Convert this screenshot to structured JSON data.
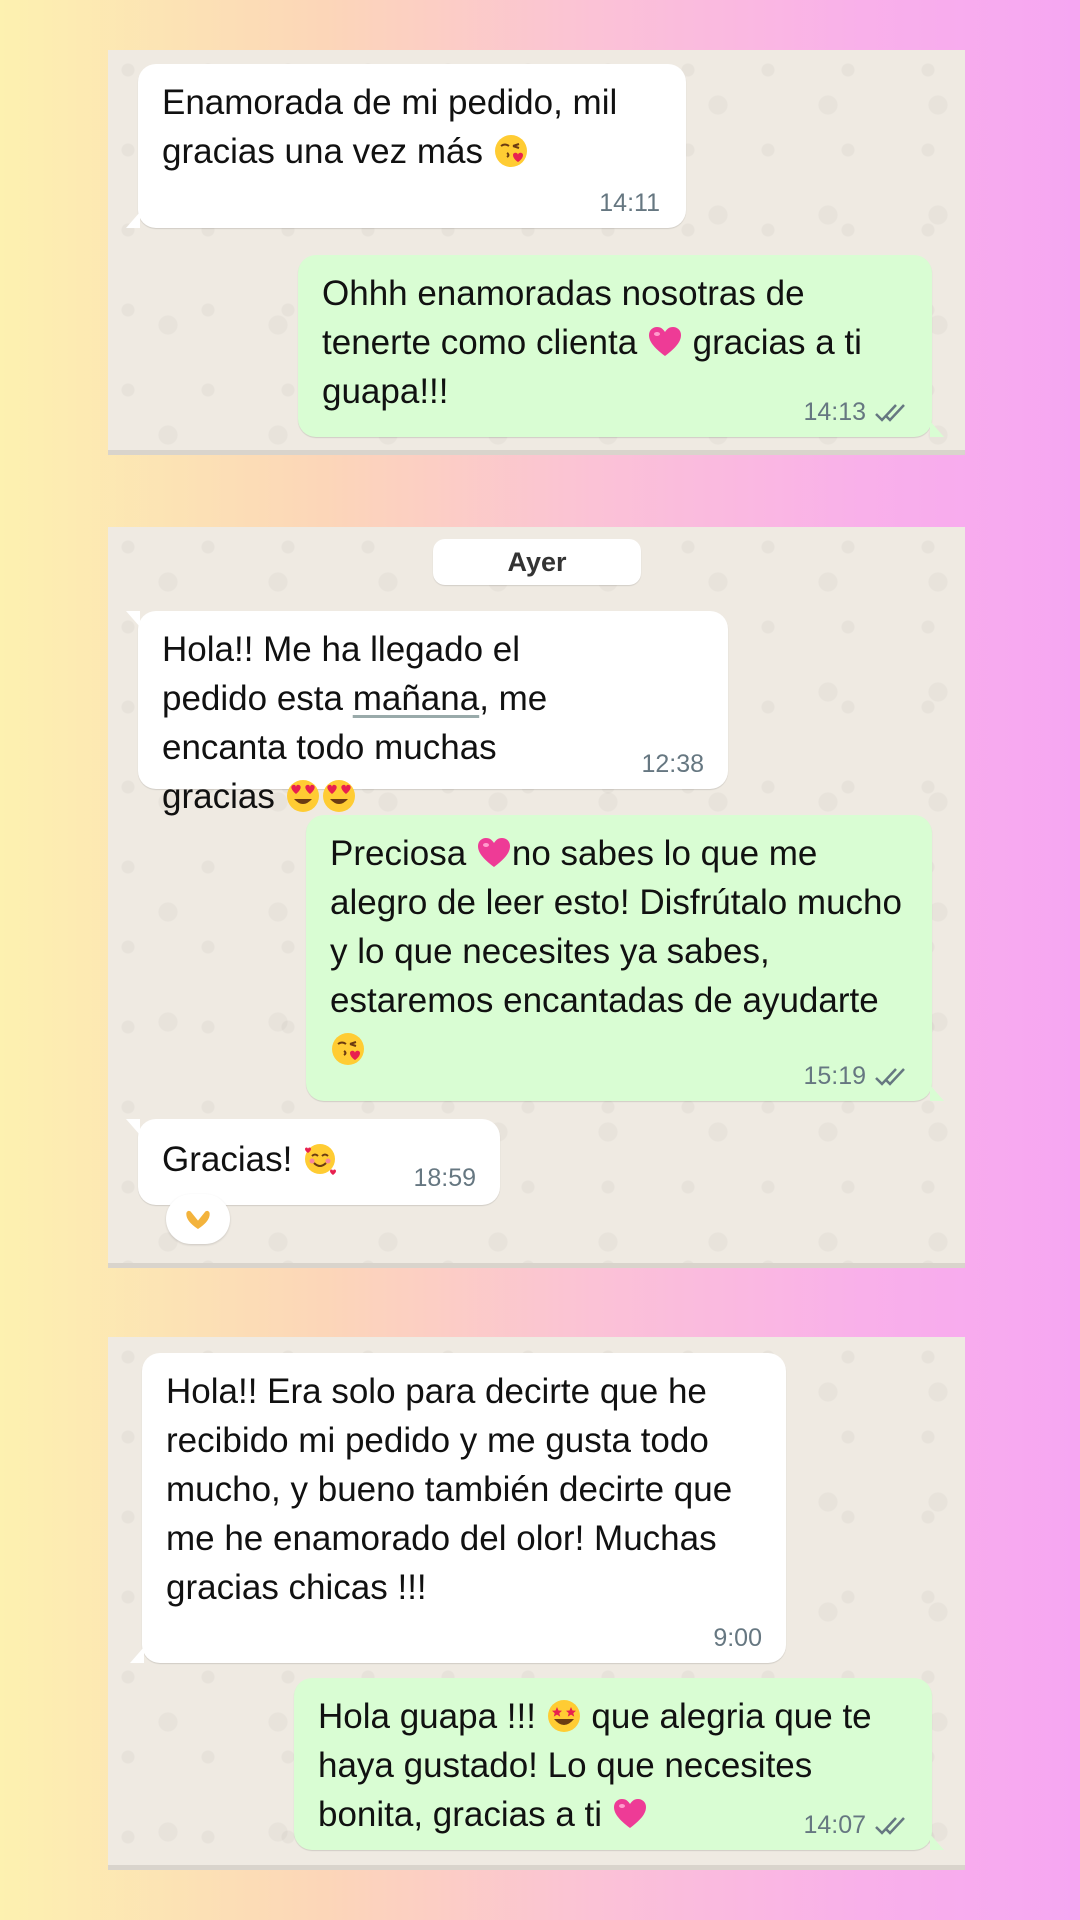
{
  "panel1": {
    "msg1": {
      "text": "Enamorada de mi pedido, mil gracias una vez más",
      "emoji": "kissing-face-with-heart-icon",
      "time": "14:11"
    },
    "msg2": {
      "text_a": "Ohhh enamoradas nosotras de tenerte como clienta",
      "emoji": "pink-heart-icon",
      "text_b": "gracias a ti guapa!!!",
      "time": "14:13"
    }
  },
  "panel2": {
    "day_label": "Ayer",
    "msg1": {
      "text_a": "Hola!! Me ha llegado el pedido esta",
      "underlined": "mañana",
      "text_b": ", me encanta todo muchas gracias",
      "emoji": "heart-eyes-icon",
      "time": "12:38"
    },
    "msg2": {
      "text_a": "Preciosa",
      "emoji1": "pink-heart-icon",
      "text_b": "no sabes lo que me alegro de leer esto! Disfrútalo mucho y lo que necesites ya sabes, estaremos encantadas de ayudarte",
      "emoji2": "kissing-face-with-heart-icon",
      "time": "15:19"
    },
    "msg3": {
      "text": "Gracias!",
      "emoji": "smiling-face-with-hearts-icon",
      "time": "18:59",
      "reaction": "heart-hands-icon"
    }
  },
  "panel3": {
    "msg1": {
      "text": "Hola!! Era solo para decirte que he recibido mi pedido y me gusta todo mucho, y bueno también decirte que me he enamorado del olor! Muchas gracias chicas !!!",
      "time": "9:00"
    },
    "msg2": {
      "text_a": "Hola guapa !!!",
      "emoji1": "star-struck-icon",
      "text_b": "que alegria que te haya gustado! Lo que necesites bonita, gracias a ti",
      "emoji2": "pink-heart-icon",
      "time": "14:07"
    }
  },
  "colors": {
    "incoming_bubble": "#ffffff",
    "outgoing_bubble": "#d9fdd3",
    "chat_background": "#efeae2",
    "read_ticks": "#667781"
  }
}
